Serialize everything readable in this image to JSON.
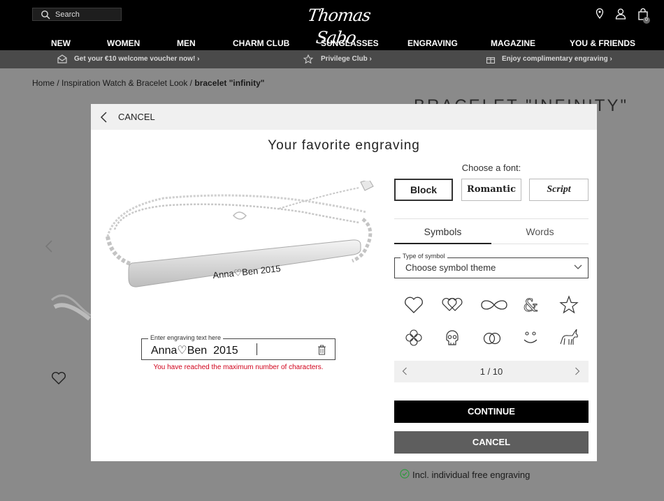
{
  "header": {
    "search_placeholder": "Search",
    "logo_text": "Thomas Sabo",
    "cart_count": "0",
    "nav": [
      "NEW",
      "WOMEN",
      "MEN",
      "CHARM CLUB",
      "SUNGLASSES",
      "ENGRAVING",
      "MAGAZINE",
      "YOU & FRIENDS"
    ]
  },
  "promo": {
    "voucher": "Get your €10 welcome voucher now!",
    "privilege": "Privilege Club",
    "engraving": "Enjoy complimentary engraving"
  },
  "page": {
    "breadcrumb_home": "Home",
    "breadcrumb_sep": " / ",
    "breadcrumb_look": "Inspiration Watch & Bracelet Look",
    "breadcrumb_current": "bracelet \"infinity\"",
    "product_title": "BRACELET \"INFINITY\"",
    "free_engraving": "Incl. individual free engraving"
  },
  "modal": {
    "cancel_top": "CANCEL",
    "title": "Your favorite engraving",
    "preview_text": "Anna♡Ben 2015",
    "engraving_label": "Enter engraving text here",
    "engraving_value": "Anna♡Ben  2015",
    "error": "You have reached the maximum number of characters.",
    "choose_font": "Choose a font:",
    "fonts": [
      "Block",
      "Romantic",
      "Script"
    ],
    "tabs": [
      "Symbols",
      "Words"
    ],
    "symbol_type_label": "Type of symbol",
    "symbol_type_value": "Choose symbol theme",
    "symbols": [
      "heart-icon",
      "double-heart-icon",
      "infinity-icon",
      "ampersand-icon",
      "star-icon",
      "clover-icon",
      "skull-icon",
      "rings-icon",
      "smiley-icon",
      "unicorn-icon"
    ],
    "pager": "1 / 10",
    "continue": "CONTINUE",
    "cancel": "CANCEL"
  }
}
